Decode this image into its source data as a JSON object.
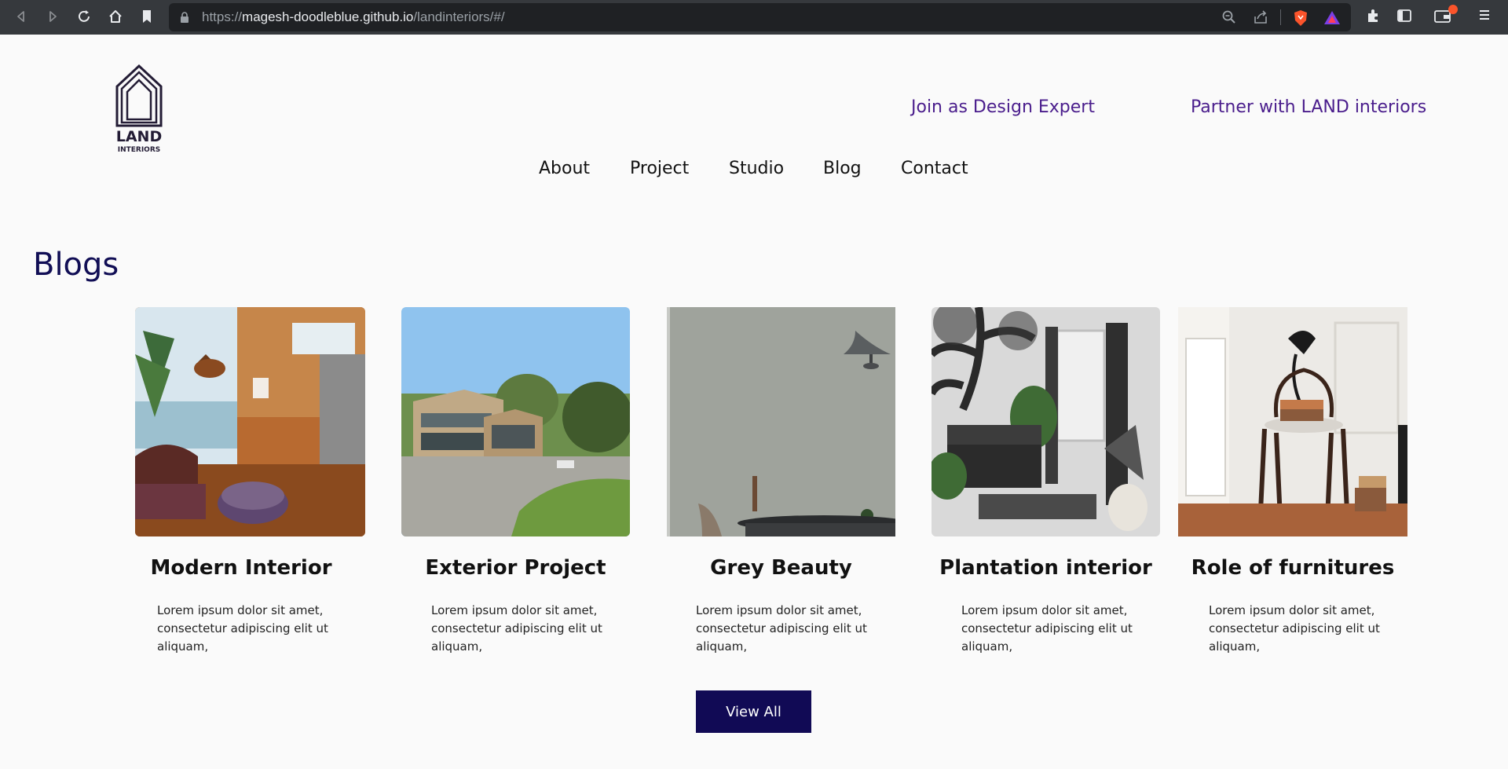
{
  "browser": {
    "url_scheme": "https://",
    "url_host": "magesh-doodleblue.github.io",
    "url_path": "/landinteriors/#/"
  },
  "header": {
    "logo_text_1": "LAND",
    "logo_text_2": "INTERIORS",
    "join_link": "Join as Design Expert",
    "partner_link": "Partner with LAND interiors"
  },
  "nav": {
    "about": "About",
    "project": "Project",
    "studio": "Studio",
    "blog": "Blog",
    "contact": "Contact"
  },
  "blogs": {
    "title": "Blogs",
    "cards": [
      {
        "title": "Modern Interior",
        "text": "Lorem ipsum dolor sit amet, consectetur adipiscing elit ut aliquam,"
      },
      {
        "title": "Exterior Project",
        "text": "Lorem ipsum dolor sit amet, consectetur adipiscing elit ut aliquam,"
      },
      {
        "title": "Grey Beauty",
        "text": "Lorem ipsum dolor sit amet, consectetur adipiscing elit ut aliquam,"
      },
      {
        "title": "Plantation interior",
        "text": "Lorem ipsum dolor sit amet, consectetur adipiscing elit ut aliquam,"
      },
      {
        "title": "Role of furnitures",
        "text": "Lorem ipsum dolor sit amet, consectetur adipiscing elit ut aliquam,"
      }
    ],
    "view_all": "View All"
  },
  "colors": {
    "brand_purple": "#4a1d8c",
    "navy": "#110a55",
    "chrome_bg": "#36393d"
  }
}
